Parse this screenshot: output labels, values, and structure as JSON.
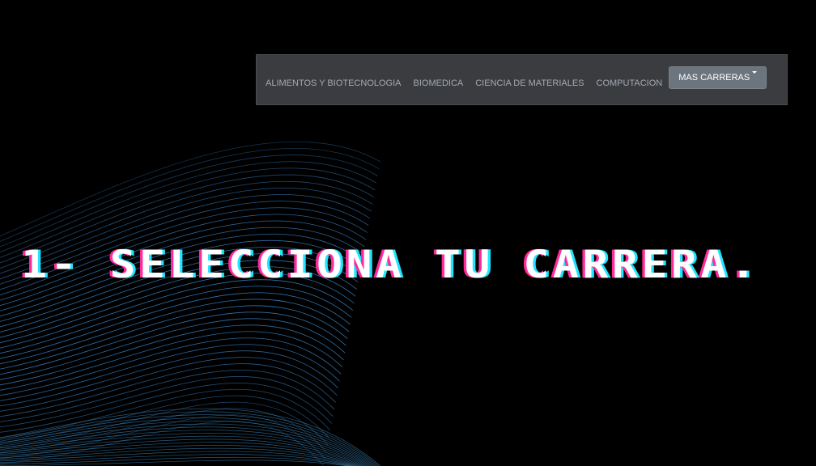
{
  "navbar": {
    "links": [
      "ALIMENTOS Y BIOTECNOLOGIA",
      "BIOMEDICA",
      "CIENCIA DE MATERIALES",
      "COMPUTACION"
    ],
    "more_button_label": "MAS CARRERAS"
  },
  "headline": "1- SELECCIONA TU CARRERA.",
  "colors": {
    "background": "#000000",
    "navbar_bg": "#3a3c40",
    "wave_lines": "#3d8fd6",
    "headline_shadow_pink": "#ff2b9a",
    "headline_shadow_cyan": "#22e4ff"
  }
}
